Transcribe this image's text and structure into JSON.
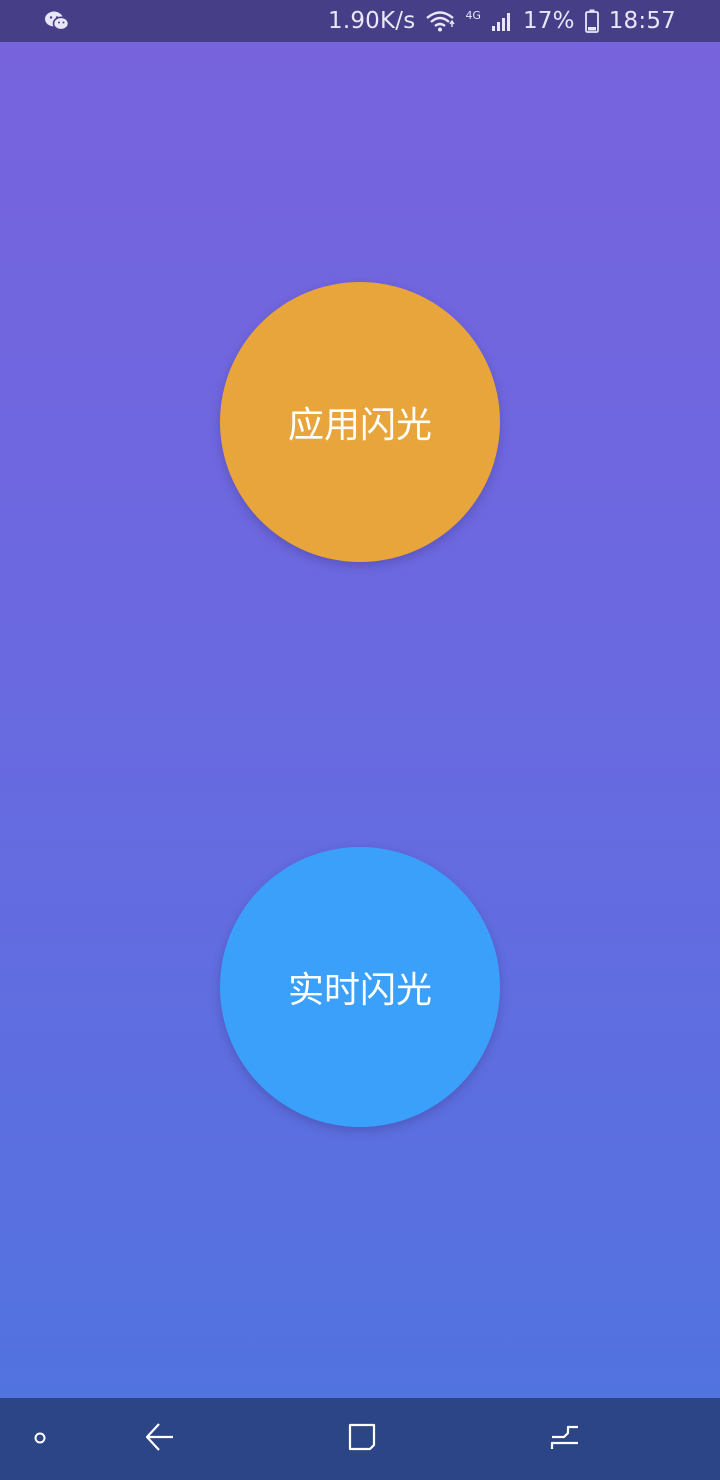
{
  "status_bar": {
    "left_icon": "wechat-icon",
    "network_speed": "1.90K/s",
    "wifi_icon": "wifi-icon",
    "network_type": "4G",
    "signal_icon": "signal-icon",
    "battery_percent": "17%",
    "battery_icon": "battery-icon",
    "time": "18:57"
  },
  "main": {
    "buttons": [
      {
        "label": "应用闪光",
        "color": "#e8a53b"
      },
      {
        "label": "实时闪光",
        "color": "#3aa0f9"
      }
    ]
  },
  "nav_bar": {
    "items": [
      "dot-icon",
      "back-icon",
      "home-icon",
      "recent-apps-icon"
    ]
  },
  "colors": {
    "status_bar_bg": "#463f87",
    "nav_bar_bg": "#2c4587",
    "gradient_top": "#7863dd",
    "gradient_bottom": "#4d74e0"
  }
}
